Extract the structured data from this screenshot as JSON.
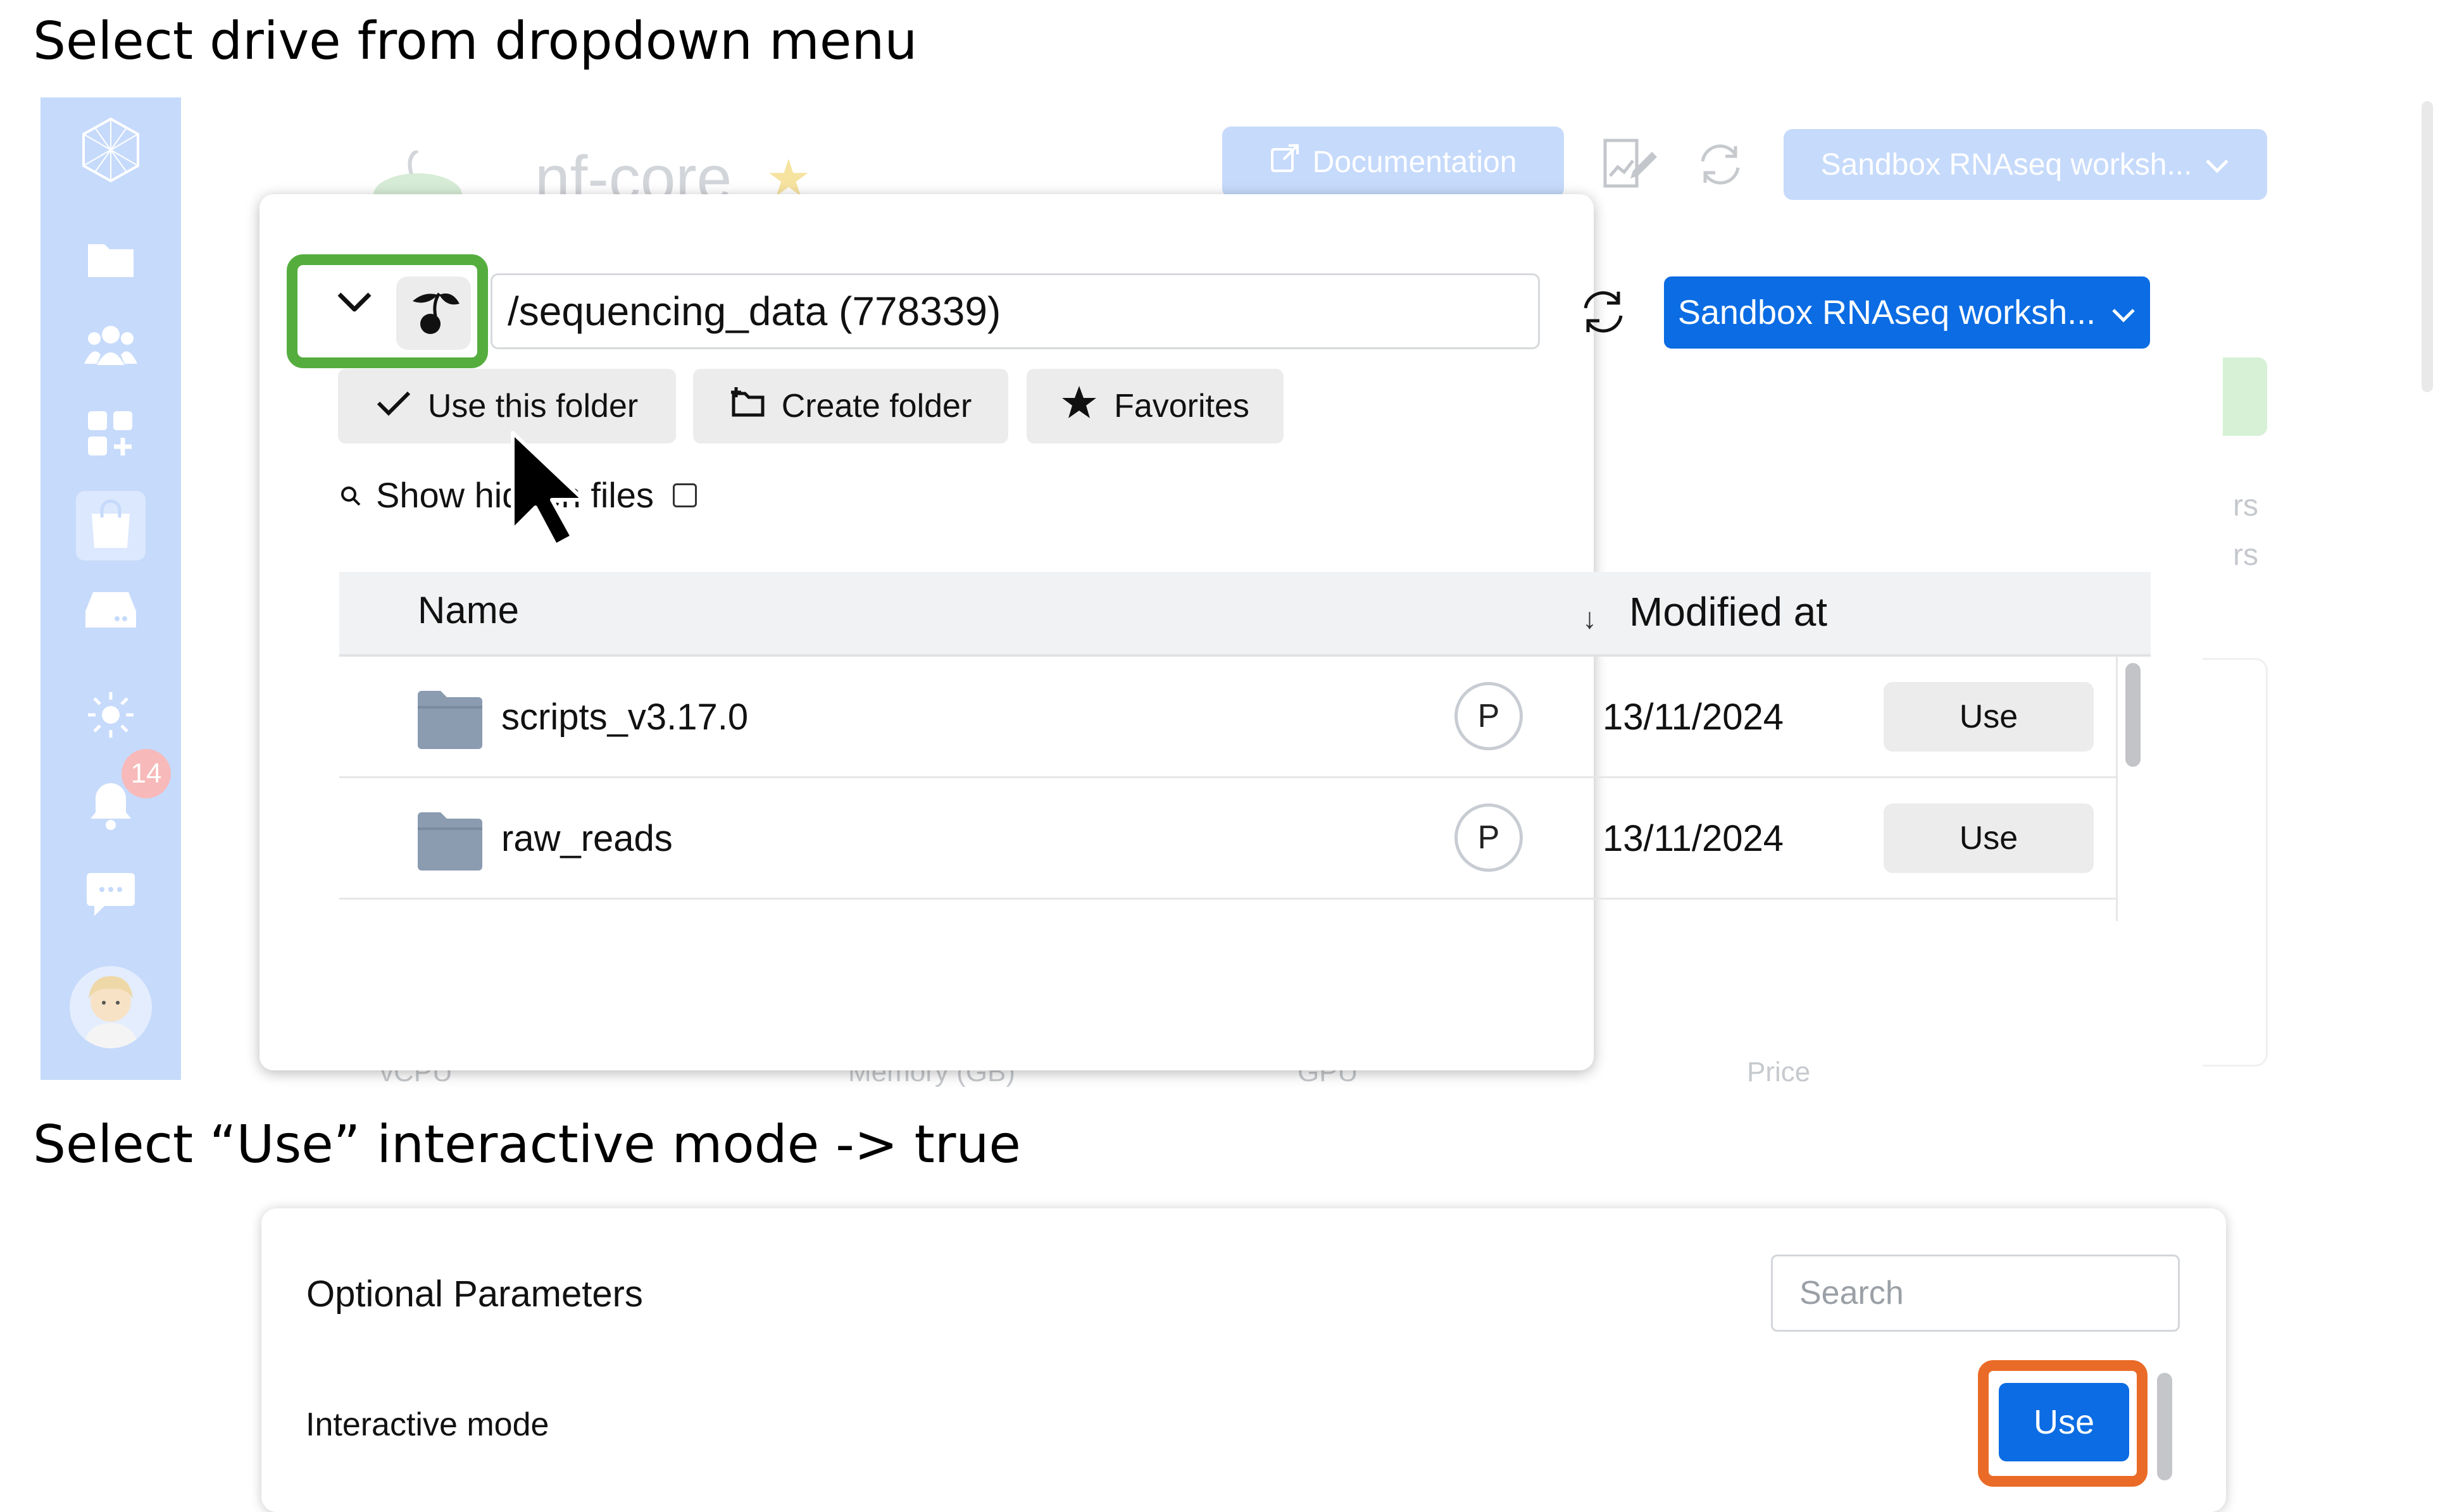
{
  "captions": {
    "top": "Select drive from dropdown menu",
    "bottom": "Select “Use” interactive mode -> true"
  },
  "background": {
    "title": "nf-core",
    "documentation_button": "Documentation",
    "workspace_button": "Sandbox RNAseq worksh...",
    "notification_count": "14",
    "fragment_1": "rs",
    "fragment_2": "rs",
    "footer_columns": [
      "vCPU",
      "Memory (GB)",
      "GPU",
      "Price"
    ]
  },
  "file_browser": {
    "path": "/sequencing_data (778339)",
    "workspace_button": "Sandbox RNAseq worksh...",
    "actions": {
      "use_folder": "Use this folder",
      "create_folder": "Create folder",
      "favorites": "Favorites"
    },
    "show_hidden_files": "Show hidden files",
    "columns": {
      "name": "Name",
      "modified": "Modified at"
    },
    "rows": [
      {
        "name": "scripts_v3.17.0",
        "owner": "P",
        "modified": "13/11/2024",
        "action": "Use"
      },
      {
        "name": "raw_reads",
        "owner": "P",
        "modified": "13/11/2024",
        "action": "Use"
      }
    ]
  },
  "optional_parameters": {
    "title": "Optional Parameters",
    "search_placeholder": "Search",
    "interactive_mode_label": "Interactive mode",
    "use_button": "Use"
  },
  "colors": {
    "primary_blue": "#0b6ce3",
    "drive_highlight": "#55ad3e",
    "use_highlight": "#ea6b27",
    "sidebar": "#c6dafb"
  }
}
